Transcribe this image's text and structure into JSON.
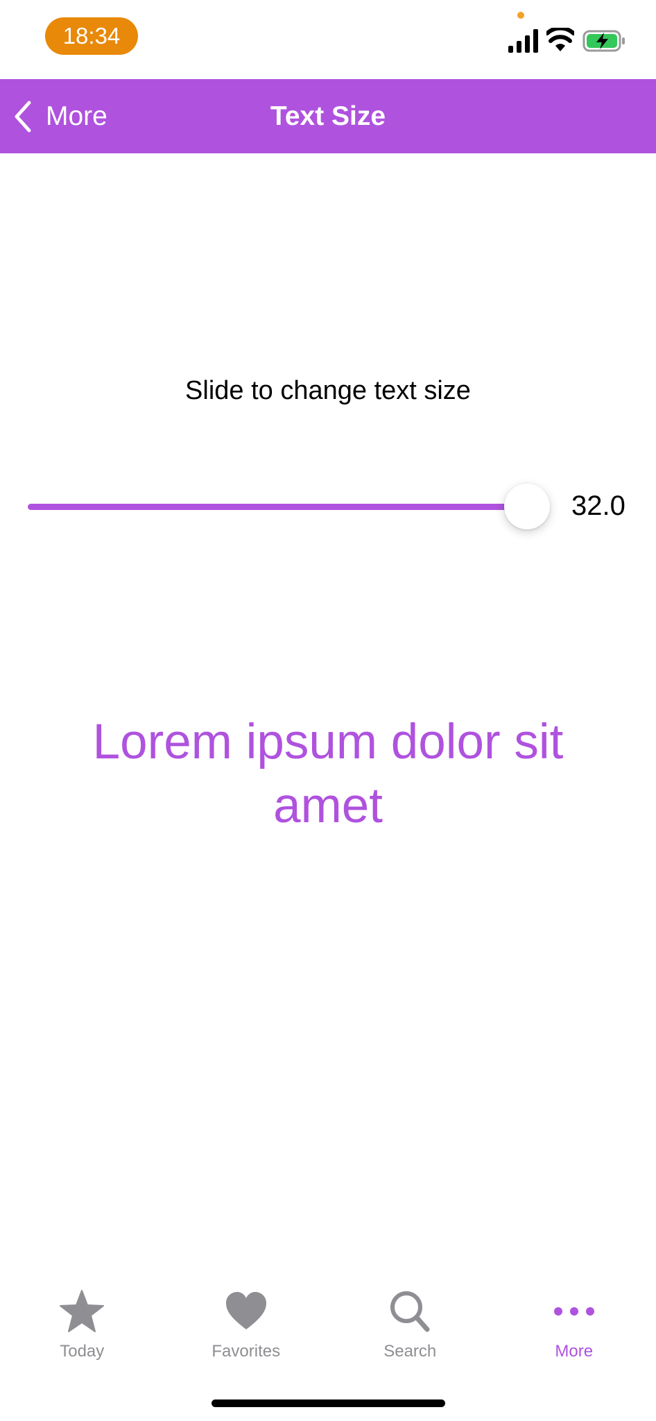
{
  "status_bar": {
    "time": "18:34",
    "time_pill_color": "#E8890A",
    "icons": [
      "cellular-signal-icon",
      "wifi-icon",
      "battery-charging-icon"
    ]
  },
  "nav": {
    "back_label": "More",
    "title": "Text Size",
    "background": "#AF52DE"
  },
  "content": {
    "instruction": "Slide to change text size",
    "slider": {
      "value": 32.0,
      "value_label": "32.0",
      "fill_fraction": 0.96,
      "accent": "#AF52DE"
    },
    "preview_text": "Lorem ipsum dolor sit amet"
  },
  "tab_bar": {
    "tabs": [
      {
        "label": "Today",
        "icon": "star-icon",
        "active": false
      },
      {
        "label": "Favorites",
        "icon": "heart-icon",
        "active": false
      },
      {
        "label": "Search",
        "icon": "magnifying-glass-icon",
        "active": false
      },
      {
        "label": "More",
        "icon": "more-dots-icon",
        "active": true
      }
    ],
    "active_color": "#AF52DE",
    "inactive_color": "#8E8E93"
  }
}
